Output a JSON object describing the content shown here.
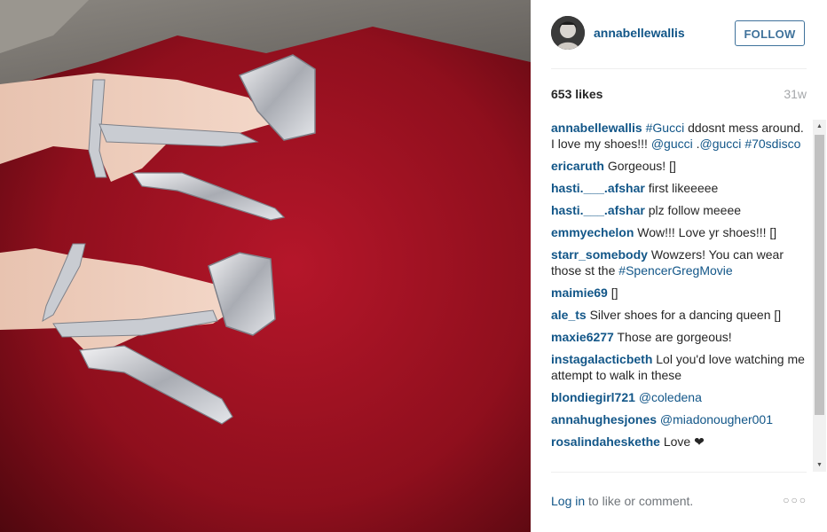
{
  "post": {
    "username": "annabellewallis",
    "follow_label": "FOLLOW",
    "likes": "653 likes",
    "time": "31w",
    "caption": {
      "user": "annabellewallis",
      "parts": [
        {
          "text": "#Gucci",
          "tag": true
        },
        {
          "text": " ddosnt mess around. I love my shoes!!! ",
          "tag": false
        },
        {
          "text": "@gucci",
          "tag": true
        },
        {
          "text": " .",
          "tag": false
        },
        {
          "text": "@gucci",
          "tag": true
        },
        {
          "text": " ",
          "tag": false
        },
        {
          "text": "#70sdisco",
          "tag": true
        }
      ]
    }
  },
  "comments": [
    {
      "user": "ericaruth",
      "parts": [
        {
          "text": "Gorgeous! []",
          "tag": false
        }
      ]
    },
    {
      "user": "hasti.___.afshar",
      "parts": [
        {
          "text": "first likeeeee",
          "tag": false
        }
      ]
    },
    {
      "user": "hasti.___.afshar",
      "parts": [
        {
          "text": "plz follow meeee",
          "tag": false
        }
      ]
    },
    {
      "user": "emmyechelon",
      "parts": [
        {
          "text": "Wow!!! Love yr shoes!!! []",
          "tag": false
        }
      ]
    },
    {
      "user": "starr_somebody",
      "parts": [
        {
          "text": "Wowzers! You can wear those st the ",
          "tag": false
        },
        {
          "text": "#SpencerGregMovie",
          "tag": true
        }
      ]
    },
    {
      "user": "maimie69",
      "parts": [
        {
          "text": "[]",
          "tag": false
        }
      ]
    },
    {
      "user": "ale_ts",
      "parts": [
        {
          "text": "Silver shoes for a dancing queen []",
          "tag": false
        }
      ]
    },
    {
      "user": "maxie6277",
      "parts": [
        {
          "text": "Those are gorgeous!",
          "tag": false
        }
      ]
    },
    {
      "user": "instagalacticbeth",
      "parts": [
        {
          "text": "Lol you'd love watching me attempt to walk in these",
          "tag": false
        }
      ]
    },
    {
      "user": "blondiegirl721",
      "parts": [
        {
          "text": "@coledena",
          "tag": true
        }
      ]
    },
    {
      "user": "annahughesjones",
      "parts": [
        {
          "text": "@miadonougher001",
          "tag": true
        }
      ]
    },
    {
      "user": "rosalindaheskethe",
      "parts": [
        {
          "text": "Love ❤",
          "tag": false
        }
      ]
    }
  ],
  "footer": {
    "login_label": "Log in",
    "rest": " to like or comment.",
    "more": "○○○"
  },
  "scrollbar": {
    "up": "▲",
    "down": "▼"
  },
  "icons": {
    "avatar": "user-avatar-icon",
    "more": "more-options-icon"
  },
  "colors": {
    "link": "#125688",
    "follow": "#3f729b",
    "rug": "#a3131f"
  }
}
